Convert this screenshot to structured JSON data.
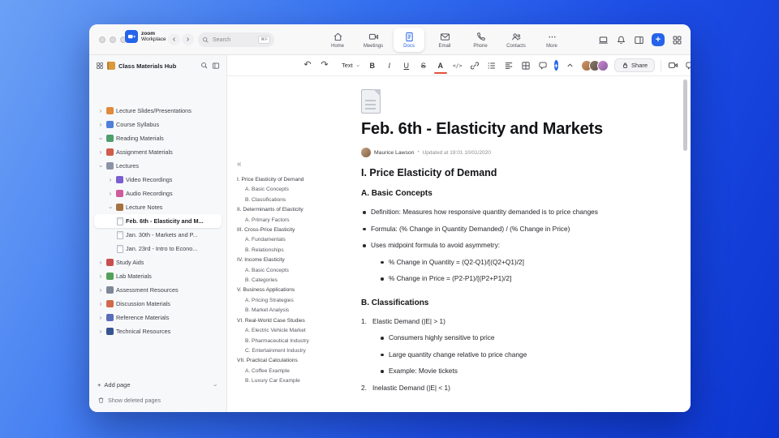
{
  "icons": {
    "back": "‹",
    "forward": "›",
    "chevron": "›",
    "collapse_outline": "«",
    "plus": "+",
    "more_dots": "···",
    "byline_sep": "•"
  },
  "topbar": {
    "logo_line1": "zoom",
    "logo_line2": "Workplace",
    "search_placeholder": "Search",
    "search_shortcut": "⌘F",
    "tabs": [
      {
        "label": "Home"
      },
      {
        "label": "Meetings"
      },
      {
        "label": "Docs",
        "active": true
      },
      {
        "label": "Email"
      },
      {
        "label": "Phone"
      },
      {
        "label": "Contacts"
      },
      {
        "label": "More"
      }
    ]
  },
  "sidebar": {
    "title": "Class Materials Hub",
    "items": [
      {
        "label": "Lecture Slides/Presentations",
        "color": "#e08a3c",
        "chevron": "right",
        "level": 0
      },
      {
        "label": "Course Syllabus",
        "color": "#4f7fd9",
        "chevron": "right",
        "level": 0
      },
      {
        "label": "Reading Materials",
        "color": "#4f9e6b",
        "chevron": "down",
        "level": 0
      },
      {
        "label": "Assignment Materials",
        "color": "#d05c4a",
        "chevron": "right",
        "level": 0
      },
      {
        "label": "Lectures",
        "color": "#8a93a6",
        "chevron": "down",
        "level": 0
      },
      {
        "label": "Video Recordings",
        "color": "#7a5fd0",
        "chevron": "right",
        "level": 1
      },
      {
        "label": "Audio Recordings",
        "color": "#d05a9e",
        "chevron": "right",
        "level": 1
      },
      {
        "label": "Lecture Notes",
        "color": "#a4713f",
        "chevron": "down",
        "level": 1
      },
      {
        "label": "Feb. 6th - Elasticity and M...",
        "page": true,
        "level": 2,
        "selected": true
      },
      {
        "label": "Jan. 30th - Markets and P...",
        "page": true,
        "level": 2
      },
      {
        "label": "Jan. 23rd - Intro to Econo...",
        "page": true,
        "level": 2
      },
      {
        "label": "Study Aids",
        "color": "#c94f4f",
        "chevron": "right",
        "level": 0
      },
      {
        "label": "Lab Materials",
        "color": "#54a05a",
        "chevron": "right",
        "level": 0
      },
      {
        "label": "Assessment Resources",
        "color": "#7d8798",
        "chevron": "right",
        "level": 0
      },
      {
        "label": "Discussion Materials",
        "color": "#d06a4a",
        "chevron": "right",
        "level": 0
      },
      {
        "label": "Reference Materials",
        "color": "#5a6db8",
        "chevron": "right",
        "level": 0
      },
      {
        "label": "Technical Resources",
        "color": "#36548f",
        "chevron": "right",
        "level": 0
      }
    ],
    "add_page_label": "Add page",
    "show_deleted_label": "Show deleted pages"
  },
  "toolbar": {
    "undo": "↶",
    "redo": "↷",
    "text_style_label": "Text",
    "bold": "B",
    "italic": "I",
    "underline": "U",
    "strike": "S",
    "color": "A",
    "code": "</>",
    "share_label": "Share"
  },
  "doc": {
    "title": "Feb. 6th - Elasticity and Markets",
    "author": "Maurice Lawson",
    "updated": "Updated at 19:01 10/01/2020",
    "outline": [
      {
        "label": "I. Price Elasticity of Demand",
        "level": 0
      },
      {
        "label": "A. Basic Concepts",
        "level": 1
      },
      {
        "label": "B. Classifications",
        "level": 1
      },
      {
        "label": "II. Determinants of Elasticity",
        "level": 0
      },
      {
        "label": "A. Primary Factors",
        "level": 1
      },
      {
        "label": "III. Cross-Price Elasticity",
        "level": 0
      },
      {
        "label": "A. Fundamentals",
        "level": 1
      },
      {
        "label": "B. Relationships",
        "level": 1
      },
      {
        "label": "IV. Income Elasticity",
        "level": 0
      },
      {
        "label": "A. Basic Concepts",
        "level": 1
      },
      {
        "label": "B. Categories",
        "level": 1
      },
      {
        "label": "V. Business Applications",
        "level": 0
      },
      {
        "label": "A. Pricing Strategies",
        "level": 1
      },
      {
        "label": "B. Market Analysis",
        "level": 1
      },
      {
        "label": "VI. Real-World Case Studies",
        "level": 0
      },
      {
        "label": "A. Electric Vehicle Market",
        "level": 1
      },
      {
        "label": "B. Pharmaceutical Industry",
        "level": 1
      },
      {
        "label": "C. Entertainment Industry",
        "level": 1
      },
      {
        "label": "VII. Practical Calculations",
        "level": 0
      },
      {
        "label": "A. Coffee Example",
        "level": 1
      },
      {
        "label": "B. Luxury Car Example",
        "level": 1
      }
    ],
    "content": {
      "h2": "I. Price Elasticity of Demand",
      "h3_a": "A. Basic Concepts",
      "bullets_a": [
        "Definition: Measures how responsive quantity demanded is to price changes",
        "Formula: (% Change in Quantity Demanded) / (% Change in Price)",
        "Uses midpoint formula to avoid asymmetry:"
      ],
      "sub_bullets_a": [
        "% Change in Quantity = (Q2-Q1)/[(Q2+Q1)/2]",
        "% Change in Price = (P2-P1)/[(P2+P1)/2]"
      ],
      "h3_b": "B. Classifications",
      "numbered": [
        {
          "num": "1.",
          "text": "Elastic Demand (|E| > 1)"
        },
        {
          "num": "2.",
          "text": "Inelastic Demand (|E| < 1)"
        }
      ],
      "sub_bullets_b": [
        "Consumers highly sensitive to price",
        "Large quantity change relative to price change",
        "Example: Movie tickets"
      ]
    }
  }
}
